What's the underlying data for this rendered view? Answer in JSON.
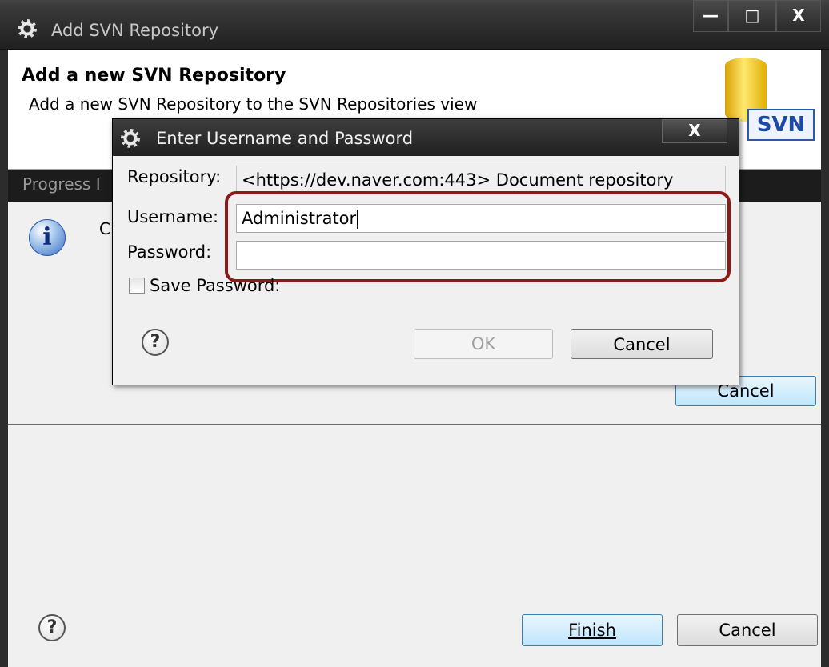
{
  "outer_window": {
    "title": "Add SVN Repository",
    "minimize_glyph": "—",
    "maximize_glyph": "□",
    "close_glyph": "X"
  },
  "banner": {
    "title": "Add a new SVN Repository",
    "description": "Add a new SVN Repository to the SVN Repositories view",
    "logo_text": "SVN"
  },
  "progress": {
    "label": "Progress I",
    "info_partial": "C"
  },
  "background_dialog": {
    "cancel_label": "Cancel"
  },
  "footer": {
    "help_glyph": "?",
    "finish_label": "Finish",
    "cancel_label": "Cancel"
  },
  "dialog": {
    "title": "Enter Username and Password",
    "close_glyph": "X",
    "repository_label": "Repository:",
    "repository_value": "<https://dev.naver.com:443> Document repository",
    "username_label": "Username:",
    "username_value": "Administrator",
    "password_label": "Password:",
    "password_value": "",
    "save_password_label": "Save Password:",
    "save_password_checked": false,
    "help_glyph": "?",
    "ok_label": "OK",
    "cancel_label": "Cancel"
  },
  "colors": {
    "highlight": "#8a1a1a",
    "default_button": "#bee6fd"
  }
}
